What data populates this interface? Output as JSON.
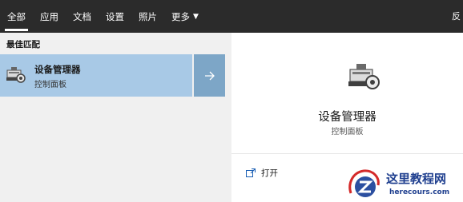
{
  "tabs": [
    {
      "label": "全部",
      "active": true
    },
    {
      "label": "应用",
      "active": false
    },
    {
      "label": "文档",
      "active": false
    },
    {
      "label": "设置",
      "active": false
    },
    {
      "label": "照片",
      "active": false
    },
    {
      "label": "更多",
      "active": false,
      "dropdown": true
    }
  ],
  "topbar_right": "反",
  "best_match": {
    "title": "最佳匹配",
    "result": {
      "name": "设备管理器",
      "subtitle": "控制面板",
      "icon": "device-manager-icon",
      "arrow_icon": "arrow-right-icon"
    }
  },
  "detail": {
    "name": "设备管理器",
    "subtitle": "控制面板",
    "icon": "device-manager-icon",
    "actions": [
      {
        "label": "打开",
        "icon": "open-window-icon"
      }
    ]
  },
  "watermark": {
    "text": "这里教程网",
    "url": "herecours.com"
  },
  "colors": {
    "topbar": "#2b2b2b",
    "selected": "#a8c9e6",
    "selected_arrow": "#7da6c7",
    "watermark": "#1f3f8f",
    "watermark_red": "#d42a2a"
  }
}
